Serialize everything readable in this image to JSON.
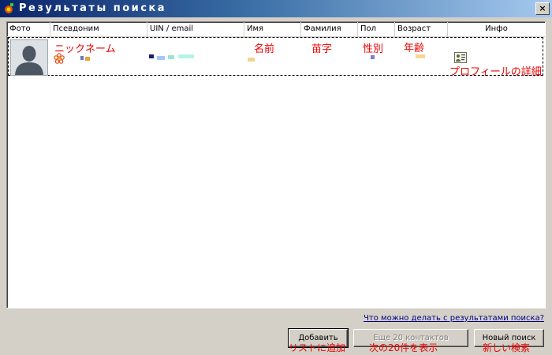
{
  "window": {
    "title": "Результаты поиска",
    "close_label": "×"
  },
  "columns": [
    "Фото",
    "Псевдоним",
    "UIN / email",
    "Имя",
    "Фамилия",
    "Пол",
    "Возраст",
    "Инфо"
  ],
  "annotations": {
    "nickname": "ニックネーム",
    "first_name": "名前",
    "last_name": "苗字",
    "gender": "性別",
    "age": "年齢",
    "profile": "プロフィールの詳細",
    "add": "リストに追加",
    "next": "次の20件を表示",
    "new_search": "新しい検索"
  },
  "help_link": "Что можно делать с результатами поиска?",
  "buttons": {
    "add": "Добавить",
    "next": "Еще 20 контактов",
    "new_search": "Новый поиск"
  },
  "icons": {
    "app": "app-icon",
    "status": "flower-status-icon",
    "info": "profile-card-icon",
    "photo": "avatar-placeholder-icon"
  },
  "colors": {
    "annotation": "#ee0000",
    "link": "#000080",
    "title_bar": "#0a246a"
  }
}
